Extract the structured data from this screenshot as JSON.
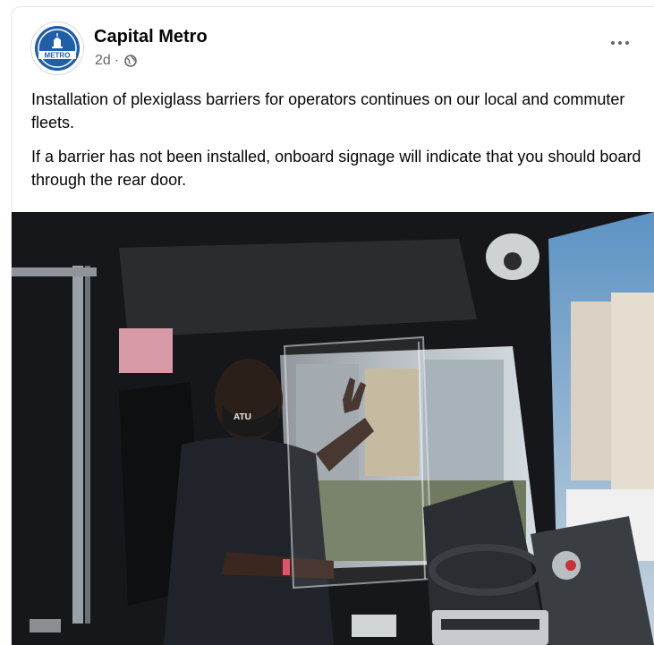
{
  "post": {
    "page_name": "Capital Metro",
    "timestamp": "2d",
    "separator": "·",
    "audience_icon": "globe-icon",
    "more_icon": "more-options-icon",
    "avatar_text": "METRO",
    "paragraphs": [
      "Installation of plexiglass barriers for operators continues on our local and commuter fleets.",
      "If a barrier has not been installed, onboard signage will indicate that you should board through the rear door."
    ],
    "photo_mask_text": "ATU"
  },
  "colors": {
    "brand_blue": "#1f5fa8",
    "name_text": "#050505",
    "meta_text": "#65676b"
  }
}
